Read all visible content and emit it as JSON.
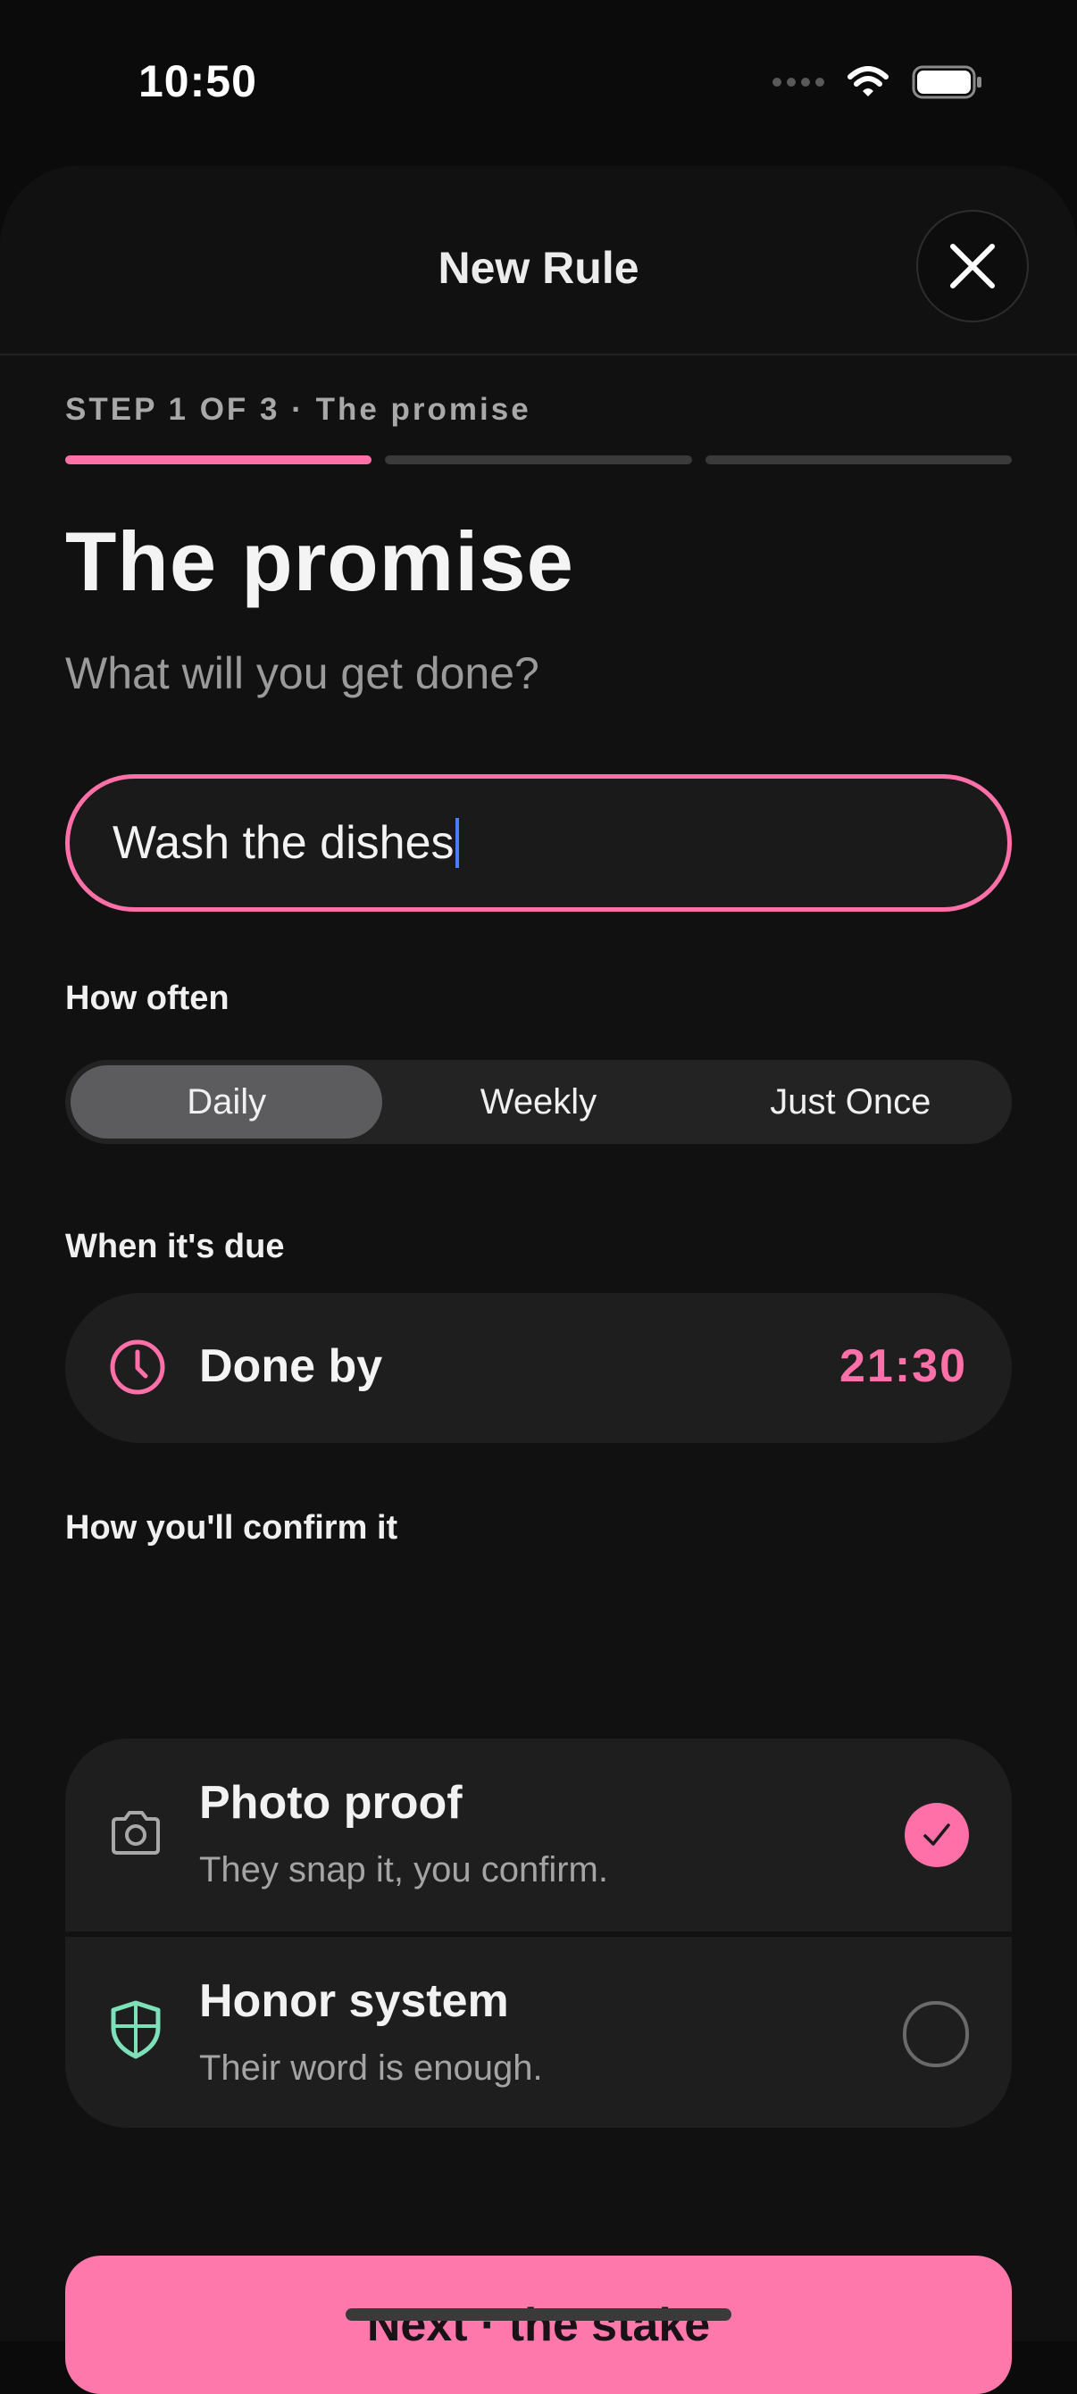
{
  "status_bar": {
    "time": "10:50"
  },
  "header": {
    "title": "New Rule",
    "close_icon": "close-icon"
  },
  "step": {
    "label": "STEP 1 OF 3 · The promise",
    "current": 1,
    "total": 3
  },
  "page": {
    "title": "The promise",
    "subtitle": "What will you get done?"
  },
  "promise_input": {
    "value": "Wash the dishes"
  },
  "frequency": {
    "label": "How often",
    "options": [
      "Daily",
      "Weekly",
      "Just Once"
    ],
    "selected": "Daily"
  },
  "due": {
    "label": "When it's due",
    "field_label": "Done by",
    "time": "21:30",
    "icon": "clock-icon"
  },
  "confirmation": {
    "label": "How you'll confirm it",
    "options": [
      {
        "title": "Photo proof",
        "description": "They snap it, you confirm.",
        "icon": "camera-icon",
        "selected": true
      },
      {
        "title": "Honor system",
        "description": "Their word is enough.",
        "icon": "shield-icon",
        "selected": false
      }
    ]
  },
  "next_button": {
    "label": "Next · the stake"
  },
  "colors": {
    "accent": "#ff6fa8",
    "button": "#ff78ac",
    "honor_icon": "#7ee0b8",
    "background": "#111111",
    "card": "#1e1e1e"
  }
}
